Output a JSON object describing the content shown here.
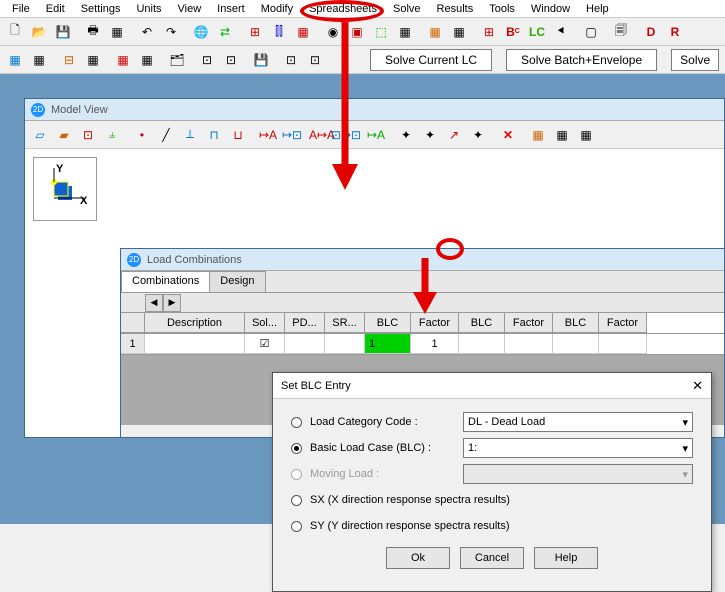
{
  "menu": [
    "File",
    "Edit",
    "Settings",
    "Units",
    "View",
    "Insert",
    "Modify",
    "Spreadsheets",
    "Solve",
    "Results",
    "Tools",
    "Window",
    "Help"
  ],
  "toolbar2": {
    "solve_current": "Solve Current LC",
    "solve_batch": "Solve Batch+Envelope",
    "solve": "Solve"
  },
  "mv": {
    "title": "Model View"
  },
  "lc": {
    "title": "Load Combinations",
    "tabs": [
      "Combinations",
      "Design"
    ],
    "cols": [
      "",
      "Description",
      "Sol...",
      "PD...",
      "SR...",
      "BLC",
      "Factor",
      "BLC",
      "Factor",
      "BLC",
      "Factor"
    ],
    "row": {
      "idx": "1",
      "desc": "",
      "sol": "☑",
      "pd": "",
      "sr": "",
      "blc1": "1",
      "fac1": "1",
      "blc2": "",
      "fac2": "",
      "blc3": "",
      "fac3": ""
    }
  },
  "dlg": {
    "title": "Set BLC Entry",
    "close": "✕",
    "r1": "Load Category Code :",
    "r1v": "DL - Dead Load",
    "r2": "Basic Load Case (BLC) :",
    "r2v": "1:",
    "r3": "Moving Load :",
    "r3v": "",
    "r4": "SX (X direction response spectra results)",
    "r5": "SY (Y direction response spectra results)",
    "ok": "Ok",
    "cancel": "Cancel",
    "help": "Help"
  },
  "lc_label": "LC",
  "axis": {
    "y": "Y",
    "x": "X"
  },
  "dd": "▾"
}
